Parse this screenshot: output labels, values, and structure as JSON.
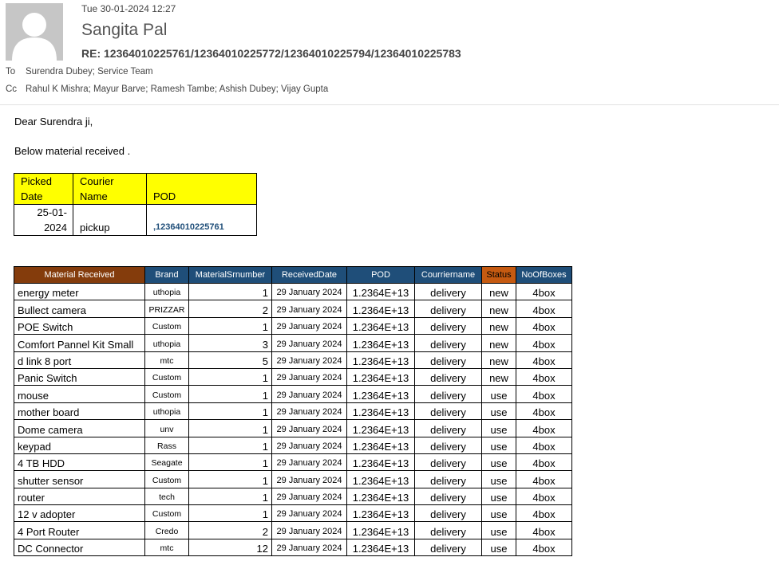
{
  "email": {
    "date": "Tue 30-01-2024 12:27",
    "from": "Sangita Pal",
    "subject": "RE: 12364010225761/12364010225772/12364010225794/12364010225783",
    "to_label": "To",
    "to": "Surendra Dubey; Service Team",
    "cc_label": "Cc",
    "cc": "Rahul K Mishra; Mayur Barve; Ramesh Tambe; Ashish Dubey; Vijay Gupta"
  },
  "body": {
    "greeting": "Dear Surendra ji,",
    "intro": "Below material received ."
  },
  "pickup_table": {
    "headers": [
      "Picked Date",
      "Courier Name",
      "POD"
    ],
    "row": {
      "date": "25-01-2024",
      "courier": "pickup",
      "pod": ",12364010225761"
    }
  },
  "material_table": {
    "headers": [
      "Material Received",
      "Brand",
      "MaterialSrnumber",
      "ReceivedDate",
      "POD",
      "Courriername",
      "Status",
      "NoOfBoxes"
    ],
    "rows": [
      {
        "material": "energy meter",
        "brand": "uthopia",
        "sr": "1",
        "date": "29 January 2024",
        "pod": "1.2364E+13",
        "courier": "delivery",
        "status": "new",
        "boxes": "4box"
      },
      {
        "material": "Bullect camera",
        "brand": "PRIZZAR",
        "sr": "2",
        "date": "29 January 2024",
        "pod": "1.2364E+13",
        "courier": "delivery",
        "status": "new",
        "boxes": "4box"
      },
      {
        "material": "POE Switch",
        "brand": "Custom",
        "sr": "1",
        "date": "29 January 2024",
        "pod": "1.2364E+13",
        "courier": "delivery",
        "status": "new",
        "boxes": "4box"
      },
      {
        "material": "Comfort Pannel Kit Small",
        "brand": "uthopia",
        "sr": "3",
        "date": "29 January 2024",
        "pod": "1.2364E+13",
        "courier": "delivery",
        "status": "new",
        "boxes": "4box"
      },
      {
        "material": "d link 8 port",
        "brand": "mtc",
        "sr": "5",
        "date": "29 January 2024",
        "pod": "1.2364E+13",
        "courier": "delivery",
        "status": "new",
        "boxes": "4box"
      },
      {
        "material": "Panic Switch",
        "brand": "Custom",
        "sr": "1",
        "date": "29 January 2024",
        "pod": "1.2364E+13",
        "courier": "delivery",
        "status": "new",
        "boxes": "4box"
      },
      {
        "material": "mouse",
        "brand": "Custom",
        "sr": "1",
        "date": "29 January 2024",
        "pod": "1.2364E+13",
        "courier": "delivery",
        "status": "use",
        "boxes": "4box"
      },
      {
        "material": "mother board",
        "brand": "uthopia",
        "sr": "1",
        "date": "29 January 2024",
        "pod": "1.2364E+13",
        "courier": "delivery",
        "status": "use",
        "boxes": "4box"
      },
      {
        "material": "Dome camera",
        "brand": "unv",
        "sr": "1",
        "date": "29 January 2024",
        "pod": "1.2364E+13",
        "courier": "delivery",
        "status": "use",
        "boxes": "4box"
      },
      {
        "material": "keypad",
        "brand": "Rass",
        "sr": "1",
        "date": "29 January 2024",
        "pod": "1.2364E+13",
        "courier": "delivery",
        "status": "use",
        "boxes": "4box"
      },
      {
        "material": "4 TB HDD",
        "brand": "Seagate",
        "sr": "1",
        "date": "29 January 2024",
        "pod": "1.2364E+13",
        "courier": "delivery",
        "status": "use",
        "boxes": "4box"
      },
      {
        "material": "shutter sensor",
        "brand": "Custom",
        "sr": "1",
        "date": "29 January 2024",
        "pod": "1.2364E+13",
        "courier": "delivery",
        "status": "use",
        "boxes": "4box"
      },
      {
        "material": "router",
        "brand": "tech",
        "sr": "1",
        "date": "29 January 2024",
        "pod": "1.2364E+13",
        "courier": "delivery",
        "status": "use",
        "boxes": "4box"
      },
      {
        "material": "12 v adopter",
        "brand": "Custom",
        "sr": "1",
        "date": "29 January 2024",
        "pod": "1.2364E+13",
        "courier": "delivery",
        "status": "use",
        "boxes": "4box"
      },
      {
        "material": "4 Port Router",
        "brand": "Credo",
        "sr": "2",
        "date": "29 January 2024",
        "pod": "1.2364E+13",
        "courier": "delivery",
        "status": "use",
        "boxes": "4box"
      },
      {
        "material": "DC Connector",
        "brand": "mtc",
        "sr": "12",
        "date": "29 January 2024",
        "pod": "1.2364E+13",
        "courier": "delivery",
        "status": "use",
        "boxes": "4box"
      }
    ]
  },
  "colors": {
    "header_blue": "#1f4e79",
    "header_brown": "#843c0c",
    "header_orange": "#c55a11",
    "highlight_yellow": "#ffff00"
  }
}
